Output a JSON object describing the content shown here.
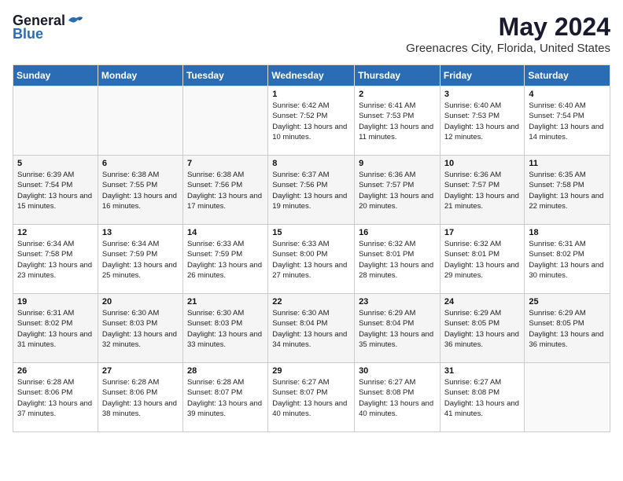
{
  "logo": {
    "general": "General",
    "blue": "Blue"
  },
  "title": "May 2024",
  "location": "Greenacres City, Florida, United States",
  "days_of_week": [
    "Sunday",
    "Monday",
    "Tuesday",
    "Wednesday",
    "Thursday",
    "Friday",
    "Saturday"
  ],
  "weeks": [
    [
      {
        "day": "",
        "info": ""
      },
      {
        "day": "",
        "info": ""
      },
      {
        "day": "",
        "info": ""
      },
      {
        "day": "1",
        "info": "Sunrise: 6:42 AM\nSunset: 7:52 PM\nDaylight: 13 hours and 10 minutes."
      },
      {
        "day": "2",
        "info": "Sunrise: 6:41 AM\nSunset: 7:53 PM\nDaylight: 13 hours and 11 minutes."
      },
      {
        "day": "3",
        "info": "Sunrise: 6:40 AM\nSunset: 7:53 PM\nDaylight: 13 hours and 12 minutes."
      },
      {
        "day": "4",
        "info": "Sunrise: 6:40 AM\nSunset: 7:54 PM\nDaylight: 13 hours and 14 minutes."
      }
    ],
    [
      {
        "day": "5",
        "info": "Sunrise: 6:39 AM\nSunset: 7:54 PM\nDaylight: 13 hours and 15 minutes."
      },
      {
        "day": "6",
        "info": "Sunrise: 6:38 AM\nSunset: 7:55 PM\nDaylight: 13 hours and 16 minutes."
      },
      {
        "day": "7",
        "info": "Sunrise: 6:38 AM\nSunset: 7:56 PM\nDaylight: 13 hours and 17 minutes."
      },
      {
        "day": "8",
        "info": "Sunrise: 6:37 AM\nSunset: 7:56 PM\nDaylight: 13 hours and 19 minutes."
      },
      {
        "day": "9",
        "info": "Sunrise: 6:36 AM\nSunset: 7:57 PM\nDaylight: 13 hours and 20 minutes."
      },
      {
        "day": "10",
        "info": "Sunrise: 6:36 AM\nSunset: 7:57 PM\nDaylight: 13 hours and 21 minutes."
      },
      {
        "day": "11",
        "info": "Sunrise: 6:35 AM\nSunset: 7:58 PM\nDaylight: 13 hours and 22 minutes."
      }
    ],
    [
      {
        "day": "12",
        "info": "Sunrise: 6:34 AM\nSunset: 7:58 PM\nDaylight: 13 hours and 23 minutes."
      },
      {
        "day": "13",
        "info": "Sunrise: 6:34 AM\nSunset: 7:59 PM\nDaylight: 13 hours and 25 minutes."
      },
      {
        "day": "14",
        "info": "Sunrise: 6:33 AM\nSunset: 7:59 PM\nDaylight: 13 hours and 26 minutes."
      },
      {
        "day": "15",
        "info": "Sunrise: 6:33 AM\nSunset: 8:00 PM\nDaylight: 13 hours and 27 minutes."
      },
      {
        "day": "16",
        "info": "Sunrise: 6:32 AM\nSunset: 8:01 PM\nDaylight: 13 hours and 28 minutes."
      },
      {
        "day": "17",
        "info": "Sunrise: 6:32 AM\nSunset: 8:01 PM\nDaylight: 13 hours and 29 minutes."
      },
      {
        "day": "18",
        "info": "Sunrise: 6:31 AM\nSunset: 8:02 PM\nDaylight: 13 hours and 30 minutes."
      }
    ],
    [
      {
        "day": "19",
        "info": "Sunrise: 6:31 AM\nSunset: 8:02 PM\nDaylight: 13 hours and 31 minutes."
      },
      {
        "day": "20",
        "info": "Sunrise: 6:30 AM\nSunset: 8:03 PM\nDaylight: 13 hours and 32 minutes."
      },
      {
        "day": "21",
        "info": "Sunrise: 6:30 AM\nSunset: 8:03 PM\nDaylight: 13 hours and 33 minutes."
      },
      {
        "day": "22",
        "info": "Sunrise: 6:30 AM\nSunset: 8:04 PM\nDaylight: 13 hours and 34 minutes."
      },
      {
        "day": "23",
        "info": "Sunrise: 6:29 AM\nSunset: 8:04 PM\nDaylight: 13 hours and 35 minutes."
      },
      {
        "day": "24",
        "info": "Sunrise: 6:29 AM\nSunset: 8:05 PM\nDaylight: 13 hours and 36 minutes."
      },
      {
        "day": "25",
        "info": "Sunrise: 6:29 AM\nSunset: 8:05 PM\nDaylight: 13 hours and 36 minutes."
      }
    ],
    [
      {
        "day": "26",
        "info": "Sunrise: 6:28 AM\nSunset: 8:06 PM\nDaylight: 13 hours and 37 minutes."
      },
      {
        "day": "27",
        "info": "Sunrise: 6:28 AM\nSunset: 8:06 PM\nDaylight: 13 hours and 38 minutes."
      },
      {
        "day": "28",
        "info": "Sunrise: 6:28 AM\nSunset: 8:07 PM\nDaylight: 13 hours and 39 minutes."
      },
      {
        "day": "29",
        "info": "Sunrise: 6:27 AM\nSunset: 8:07 PM\nDaylight: 13 hours and 40 minutes."
      },
      {
        "day": "30",
        "info": "Sunrise: 6:27 AM\nSunset: 8:08 PM\nDaylight: 13 hours and 40 minutes."
      },
      {
        "day": "31",
        "info": "Sunrise: 6:27 AM\nSunset: 8:08 PM\nDaylight: 13 hours and 41 minutes."
      },
      {
        "day": "",
        "info": ""
      }
    ]
  ]
}
